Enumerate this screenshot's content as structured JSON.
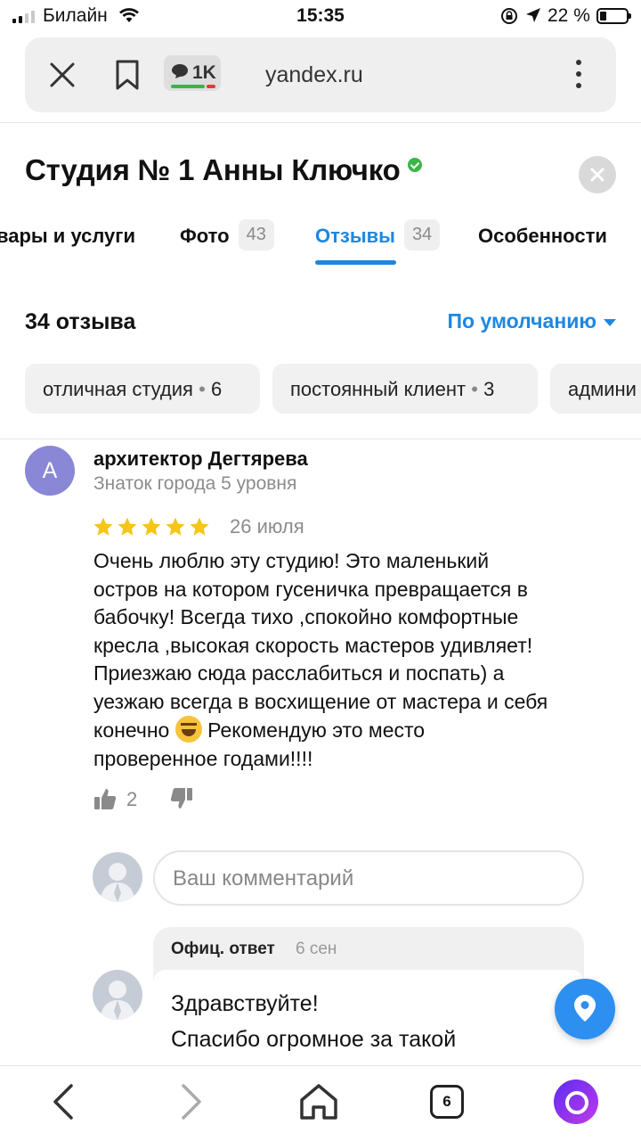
{
  "status_bar": {
    "carrier": "Билайн",
    "time": "15:35",
    "battery": "22 %"
  },
  "address_bar": {
    "comments_count": "1K",
    "url": "yandex.ru"
  },
  "header": {
    "title": "Студия № 1 Анны Ключко"
  },
  "tabs": [
    {
      "label": "вары и услуги",
      "count": ""
    },
    {
      "label": "Фото",
      "count": "43"
    },
    {
      "label": "Отзывы",
      "count": "34",
      "active": true
    },
    {
      "label": "Особенности",
      "count": ""
    }
  ],
  "reviews": {
    "count_label": "34 отзыва",
    "sort_label": "По умолчанию"
  },
  "chips": [
    {
      "label": "отличная студия",
      "count": "6"
    },
    {
      "label": "постоянный клиент",
      "count": "3"
    },
    {
      "label": "админи",
      "count": ""
    }
  ],
  "review": {
    "avatar_letter": "А",
    "author": "архитектор Дегтярева",
    "level": "Знаток города 5 уровня",
    "rating": 5,
    "date": "26 июля",
    "text_lines": [
      "Очень люблю эту студию! Это маленький",
      "остров на котором гусеничка превращается в",
      "бабочку! Всегда тихо ,спокойно комфортные",
      "кресла ,высокая скорость мастеров удивляет!",
      "Приезжаю сюда расслабиться и поспать) а",
      "уезжаю всегда в восхищение от мастера и себя",
      "конечно",
      "Рекомендую это место",
      "проверенное годами!!!!"
    ],
    "likes": "2"
  },
  "comment": {
    "placeholder": "Ваш комментарий"
  },
  "official_reply": {
    "label": "Офиц. ответ",
    "date": "6 сен",
    "lines": [
      "Здравствуйте!",
      "Спасибо огромное за такой"
    ]
  },
  "toolbar": {
    "tabs_count": "6"
  },
  "colors": {
    "accent": "#1e87e0",
    "star": "#f5c518",
    "avatar": "#8a87d6",
    "verified": "#3bb54a"
  }
}
